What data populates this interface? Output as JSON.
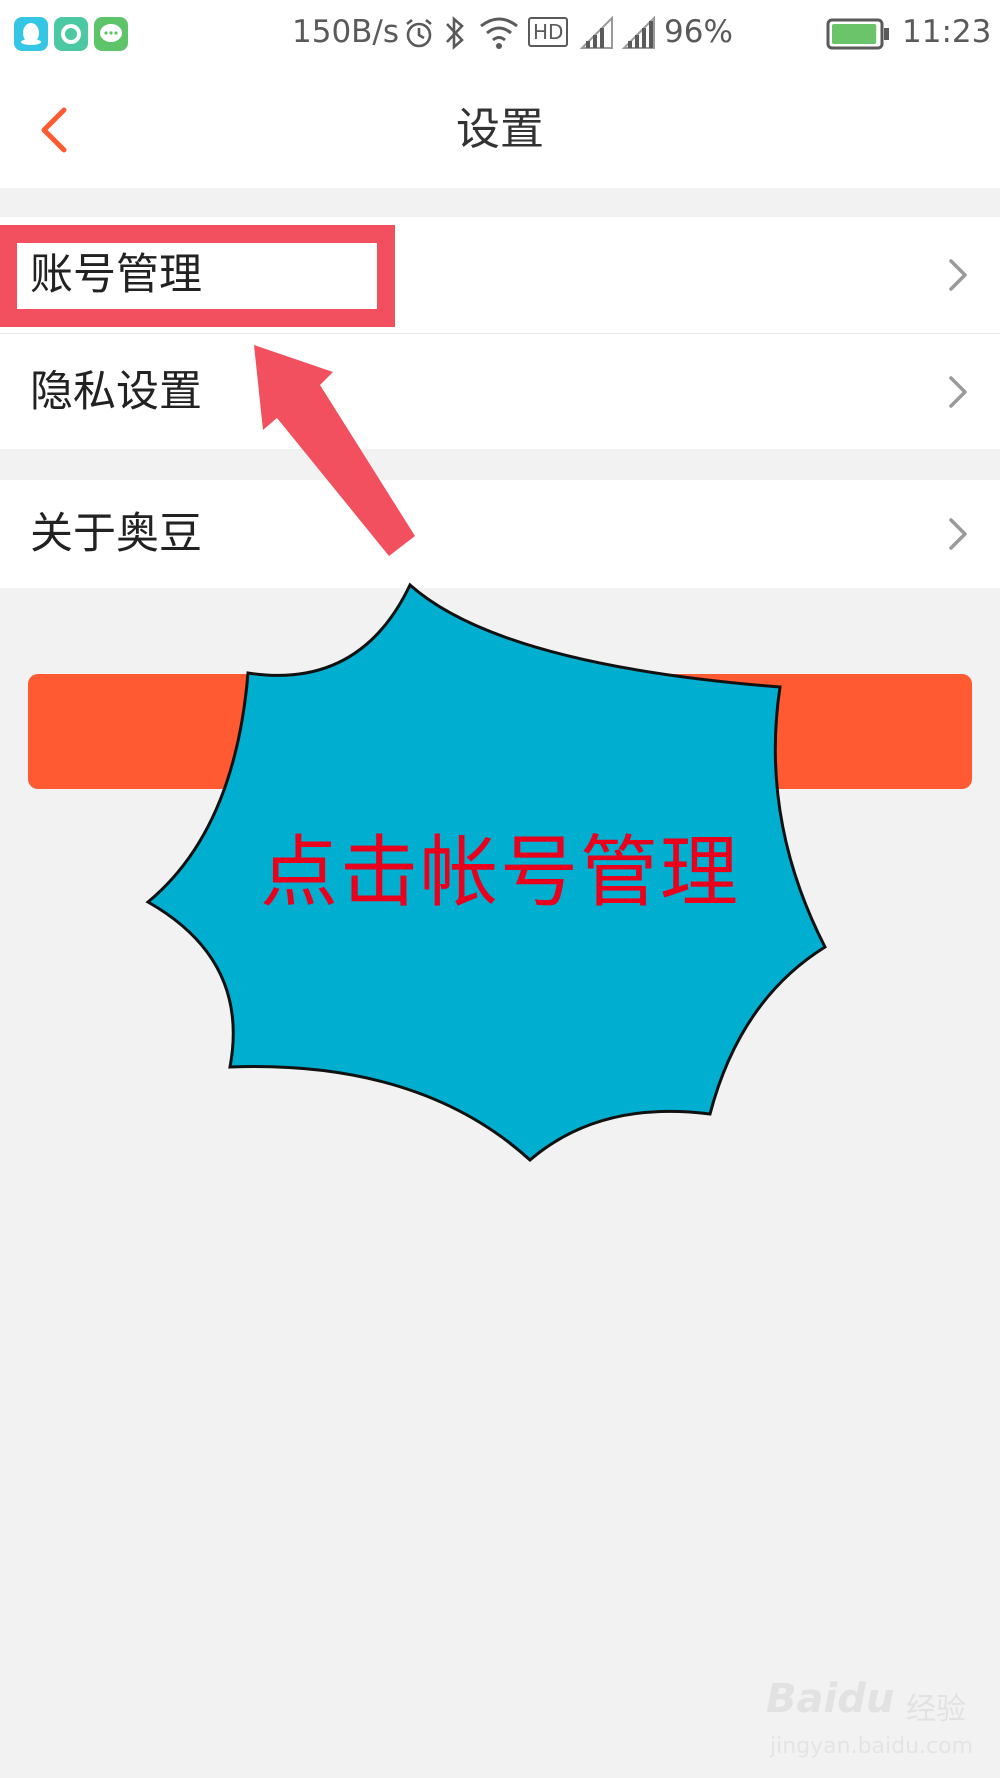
{
  "status_bar": {
    "network_speed": "150B/s",
    "hd_label": "HD",
    "battery_percent": "96%",
    "time": "11:23",
    "icons": [
      "qq-icon",
      "chat-bubble-icon",
      "message-icon",
      "alarm-icon",
      "bluetooth-icon",
      "wifi-icon",
      "signal-icon",
      "signal-icon",
      "battery-icon"
    ],
    "battery_level": 0.96
  },
  "header": {
    "title": "设置",
    "back_icon": "chevron-left-icon",
    "accent_color": "#ff5a32"
  },
  "settings": {
    "group1": [
      {
        "label": "账号管理"
      },
      {
        "label": "隐私设置"
      }
    ],
    "group2": [
      {
        "label": "关于奥豆"
      }
    ]
  },
  "primary_button": {
    "color": "#ff5a32"
  },
  "annotation": {
    "burst_text": "点击帐号管理",
    "burst_color": "#00aed0",
    "highlight_color": "#f2505e"
  },
  "watermark": {
    "brand": "Baidu",
    "cn": "经验",
    "url": "jingyan.baidu.com"
  }
}
